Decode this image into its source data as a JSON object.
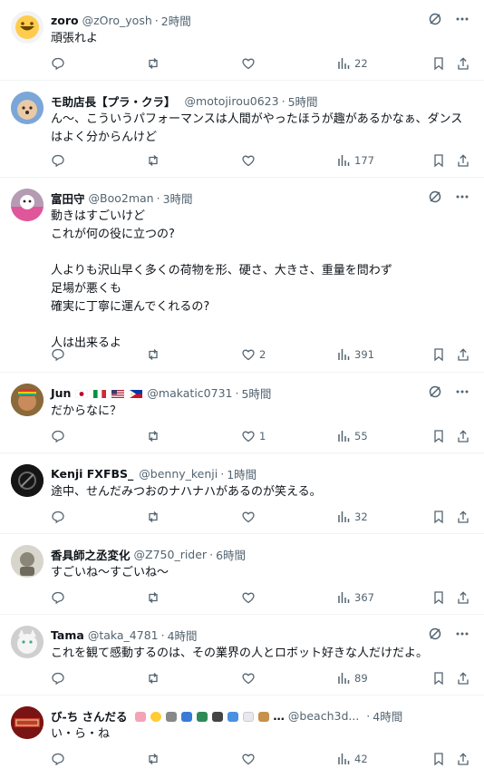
{
  "tweets": [
    {
      "name": "zoro",
      "handle": "@zOro_yosh",
      "time": "2時間",
      "text": "頑張れよ",
      "replies": "",
      "retweets": "",
      "likes": "",
      "views": "22"
    },
    {
      "name": "モ助店長【プラ・クラ】",
      "handle": "@motojirou0623",
      "time": "5時間",
      "text": "ん〜、こういうパフォーマンスは人間がやったほうが趣があるかなぁ、ダンスはよく分からんけど",
      "replies": "",
      "retweets": "",
      "likes": "",
      "views": "177"
    },
    {
      "name": "富田守",
      "handle": "@Boo2man",
      "time": "3時間",
      "text": "動きはすごいけど\nこれが何の役に立つの?\n\n人よりも沢山早く多くの荷物を形、硬さ、大きさ、重量を問わず\n足場が悪くも\n確実に丁寧に運んでくれるの?\n\n人は出来るよ",
      "replies": "",
      "retweets": "",
      "likes": "2",
      "views": "391"
    },
    {
      "name": "Jun",
      "handle": "@makatic0731",
      "time": "5時間",
      "text": "だからなに？",
      "replies": "",
      "retweets": "",
      "likes": "1",
      "views": "55"
    },
    {
      "name": "Kenji FXFBS_",
      "handle": "@benny_kenji",
      "time": "1時間",
      "text": "途中、せんだみつおのナハナハがあるのが笑える。",
      "replies": "",
      "retweets": "",
      "likes": "",
      "views": "32"
    },
    {
      "name": "香具師之丞変化",
      "handle": "@Z750_rider",
      "time": "6時間",
      "text": "すごいね〜すごいね〜",
      "replies": "",
      "retweets": "",
      "likes": "",
      "views": "367"
    },
    {
      "name": "Tama",
      "handle": "@taka_4781",
      "time": "4時間",
      "text": "これを観て感動するのは、その業界の人とロボット好きな人だけだよ。",
      "replies": "",
      "retweets": "",
      "likes": "",
      "views": "89"
    },
    {
      "name": "び-ち さんだる",
      "handle": "@beach3d...",
      "time": "4時間",
      "text": "い・ら・ね",
      "replies": "",
      "retweets": "",
      "likes": "",
      "views": "42"
    }
  ],
  "flags_jun": [
    "japan",
    "italy",
    "usa",
    "philippines"
  ],
  "emoji_beach": [
    "umbrella",
    "sun",
    "radio",
    "tv",
    "motorbike",
    "camera",
    "car",
    "rabbit",
    "dog"
  ],
  "more_marker": "…",
  "colors": {
    "text": "#0f1419",
    "secondary": "#536471",
    "divider": "#eff3f4"
  }
}
